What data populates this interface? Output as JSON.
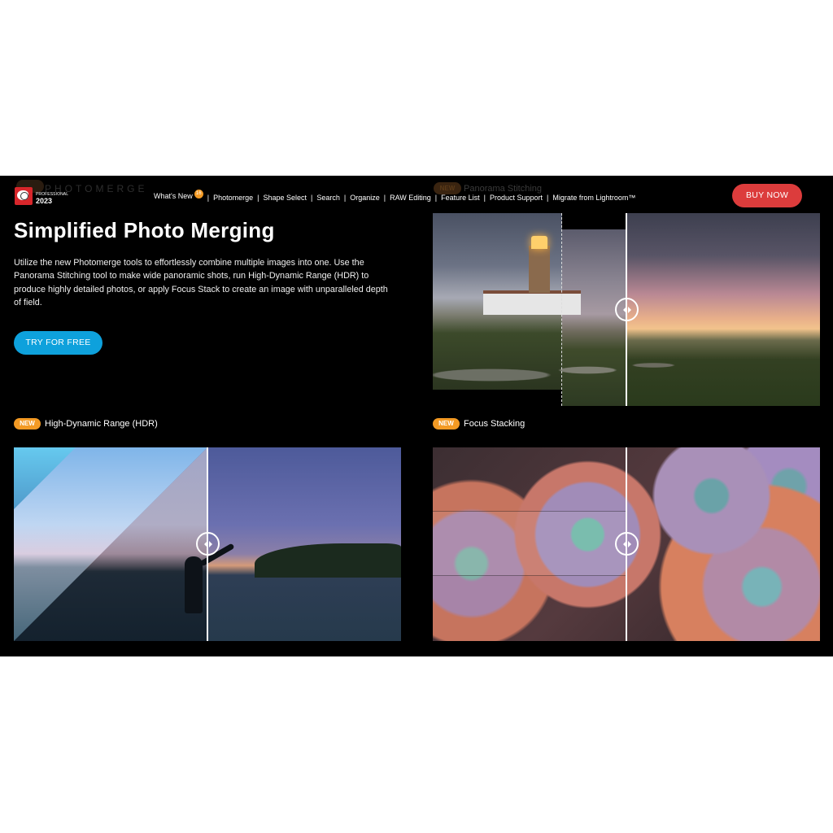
{
  "header": {
    "logo": {
      "edition": "PROFESSIONAL",
      "year": "2023",
      "faded_title": "PHOTOMERGE"
    },
    "nav": [
      {
        "label": "What's New",
        "badge": "16"
      },
      {
        "label": "Photomerge"
      },
      {
        "label": "Shape Select"
      },
      {
        "label": "Search"
      },
      {
        "label": "Organize"
      },
      {
        "label": "RAW Editing"
      },
      {
        "label": "Feature List"
      },
      {
        "label": "Product Support"
      },
      {
        "label": "Migrate from Lightroom™"
      }
    ],
    "nav_separator": "|",
    "buy_label": "BUY NOW"
  },
  "hero": {
    "title": "Simplified Photo Merging",
    "description": "Utilize the new Photomerge tools to effortlessly combine multiple images into one. Use the Panorama Stitching tool to make wide panoramic shots, run High-Dynamic Range (HDR) to produce highly detailed photos, or apply Focus Stack to create an image with unparalleled depth of field.",
    "cta_label": "TRY FOR FREE"
  },
  "features": [
    {
      "badge": "NEW",
      "label": "Panorama Stitching",
      "image": "lighthouse panorama comparison",
      "faded": true
    },
    {
      "badge": "NEW",
      "label": "High-Dynamic Range (HDR)",
      "image": "beach sunset HDR comparison"
    },
    {
      "badge": "NEW",
      "label": "Focus Stacking",
      "image": "succulents focus stack comparison"
    }
  ],
  "colors": {
    "background": "#000000",
    "buy_button": "#dc3c3c",
    "try_button": "#0ea1dc",
    "new_badge": "#f39a24"
  },
  "icons": {
    "compare_handle": "compare-slider-handle-icon"
  }
}
